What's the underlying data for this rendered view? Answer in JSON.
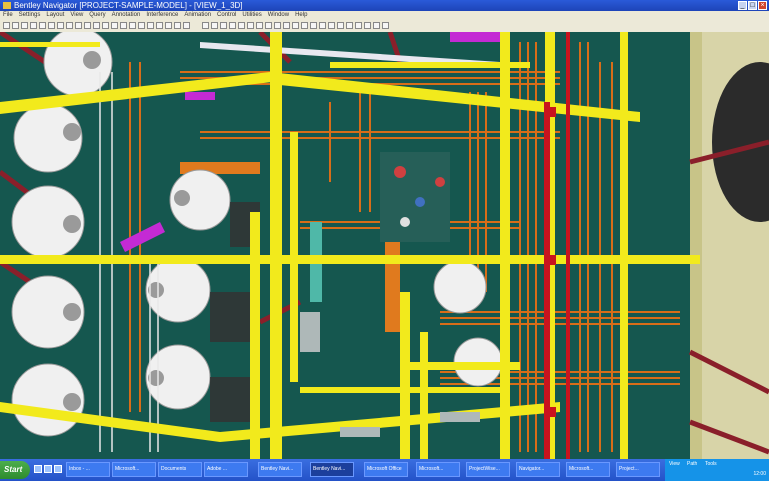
{
  "window": {
    "title": "Bentley Navigator [PROJECT-SAMPLE-MODEL] - [VIEW_1_3D]"
  },
  "menu": [
    "File",
    "Settings",
    "Layout",
    "View",
    "Query",
    "Annotation",
    "Interference",
    "Animation",
    "Control",
    "Utilities",
    "Window",
    "Help"
  ],
  "taskbar": {
    "start_label": "Start",
    "tasks": [
      "Inbox - ...",
      "Microsoft...",
      "Documents",
      "Bentley Navi...",
      "Adobe ...",
      "Bentley Navi...",
      "Microsoft Office",
      "Microsoft...",
      "ProjectWise...",
      "Navigator...",
      "Microsoft...",
      "Project..."
    ],
    "active_task_index": 3,
    "tray_labels": [
      "View",
      "Path",
      "Tools"
    ],
    "clock": "12:00"
  }
}
